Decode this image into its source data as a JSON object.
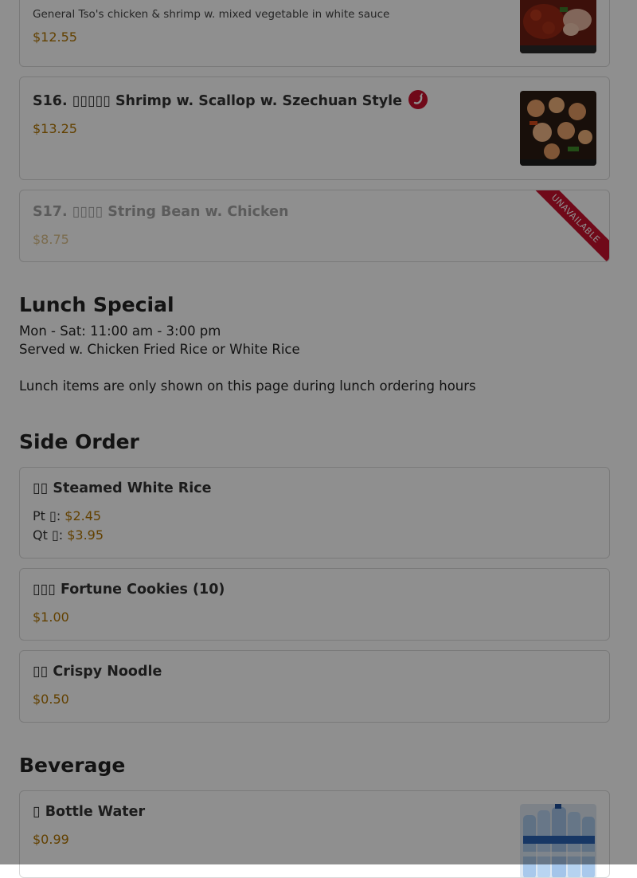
{
  "items_top": {
    "prev_desc": "General Tso's chicken & shrimp w. mixed vegetable in white sauce",
    "prev_price": "$12.55",
    "s16_name": "S16. ▯▯▯▯▯ Shrimp w. Scallop w. Szechuan Style",
    "s16_price": "$13.25",
    "s17_name": "S17. ▯▯▯▯ String Bean w. Chicken",
    "s17_price": "$8.75",
    "unavailable_label": "UNAVAILABLE"
  },
  "lunch": {
    "title": "Lunch Special",
    "hours": "Mon - Sat: 11:00 am - 3:00 pm",
    "served": "Served w. Chicken Fried Rice or White Rice",
    "note": "Lunch items are only shown on this page during lunch ordering hours"
  },
  "side_order": {
    "title": "Side Order",
    "rice_name": "▯▯ Steamed White Rice",
    "rice_pt_label": "Pt ▯: ",
    "rice_pt_price": "$2.45",
    "rice_qt_label": "Qt ▯: ",
    "rice_qt_price": "$3.95",
    "cookies_name": "▯▯▯ Fortune Cookies (10)",
    "cookies_price": "$1.00",
    "noodle_name": "▯▯ Crispy Noodle",
    "noodle_price": "$0.50"
  },
  "beverage": {
    "title": "Beverage",
    "water_name": "▯ Bottle Water",
    "water_price": "$0.99"
  },
  "colors": {
    "price": "#b07400",
    "accent_red": "#c8102e",
    "overlay": "rgba(0,0,0,0.44)"
  },
  "icons": [
    "chili-pepper-icon"
  ]
}
